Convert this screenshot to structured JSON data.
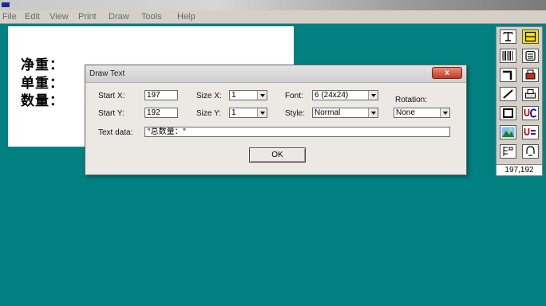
{
  "window": {
    "title": ""
  },
  "menu": [
    "File",
    "Edit",
    "View",
    "Print",
    "Draw",
    "Tools",
    "Help"
  ],
  "canvas": {
    "lines": [
      "净重：",
      "单重：",
      "数量："
    ]
  },
  "toolbox": {
    "coord": "197,192",
    "tools": [
      "text-tool-icon",
      "rectangle-tool-icon",
      "barcode-tool-icon",
      "list-tool-icon",
      "line-tool-icon",
      "print-tool-icon",
      "diagonal-line-tool-icon",
      "printer-tool-icon",
      "box-tool-icon",
      "variable-counter-icon",
      "image-tool-icon",
      "variable-assign-icon",
      "layout-tool-icon",
      "tool-settings-icon"
    ]
  },
  "dialog": {
    "title": "Draw Text",
    "close": "x",
    "start_x_label": "Start X:",
    "start_x": "197",
    "start_y_label": "Start Y:",
    "start_y": "192",
    "size_x_label": "Size X:",
    "size_x": "1",
    "size_y_label": "Size Y:",
    "size_y": "1",
    "font_label": "Font:",
    "font": "6  (24x24)",
    "style_label": "Style:",
    "style": "Normal",
    "rotation_label": "Rotation:",
    "rotation": "None",
    "text_label": "Text data:",
    "text_value": "\"总数量：\"",
    "ok": "OK"
  },
  "colors": {
    "desktop": "#008080",
    "close": "#c23a24"
  }
}
